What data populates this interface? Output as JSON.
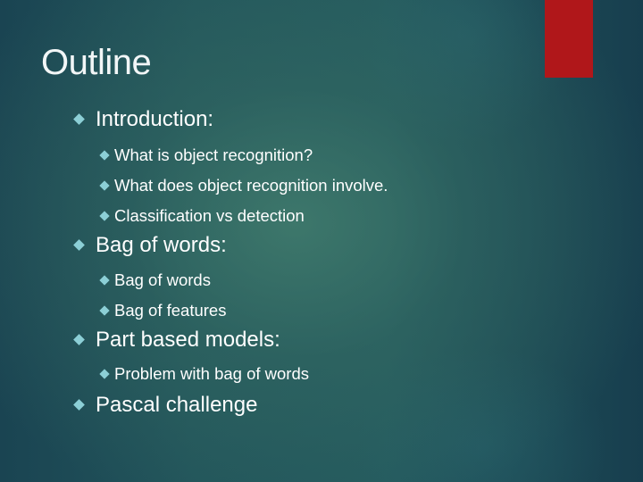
{
  "slide": {
    "title": "Outline",
    "accent_color": "#b0171a",
    "bullet_icon": "diamond-bullet-icon",
    "bullet_color": "#8ccfd6",
    "items": [
      {
        "level": 1,
        "text": "Introduction:"
      },
      {
        "level": 2,
        "text": "What is object recognition?"
      },
      {
        "level": 2,
        "text": "What does object recognition involve."
      },
      {
        "level": 2,
        "text": "Classification vs detection"
      },
      {
        "level": 1,
        "text": "Bag of words:"
      },
      {
        "level": 2,
        "text": "Bag of words"
      },
      {
        "level": 2,
        "text": "Bag of features"
      },
      {
        "level": 1,
        "text": "Part based models:"
      },
      {
        "level": 2,
        "text": "Problem with bag of words"
      },
      {
        "level": 1,
        "text": "Pascal challenge"
      }
    ]
  }
}
